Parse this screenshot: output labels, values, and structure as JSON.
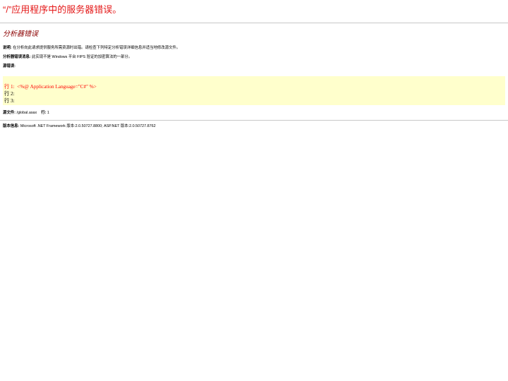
{
  "header": {
    "title": "“/”应用程序中的服务器错误。"
  },
  "error": {
    "heading": "分析器错误",
    "description_label": "说明:",
    "description_text": " 在分析向此请求提供服务所需资源时出错。请检查下列特定分析错误详细信息并适当地修改源文件。",
    "parser_message_label": "分析器错误消息:",
    "parser_message_text": " 此实现不是 Windows 平台 FIPS 验证的加密算法的一部分。",
    "source_error_label": "源错误:"
  },
  "code": {
    "lines": [
      {
        "label": "行 1:",
        "content": "  <%@ Application Language=\"C#\" %>"
      },
      {
        "label": "行 2:",
        "content": ""
      },
      {
        "label": "行 3:",
        "content": ""
      }
    ]
  },
  "source_file": {
    "file_label": "源文件:",
    "file_value": " /global.asax",
    "line_label": "行:",
    "line_value": " 1"
  },
  "version": {
    "label": "版本信息:",
    "text": " Microsoft .NET Framework 版本:2.0.50727.8800; ASP.NET 版本:2.0.50727.8762"
  },
  "colors": {
    "title": "#e41818",
    "heading": "#8b0000",
    "code_background": "#ffffcc",
    "code_error": "#ff0000"
  }
}
